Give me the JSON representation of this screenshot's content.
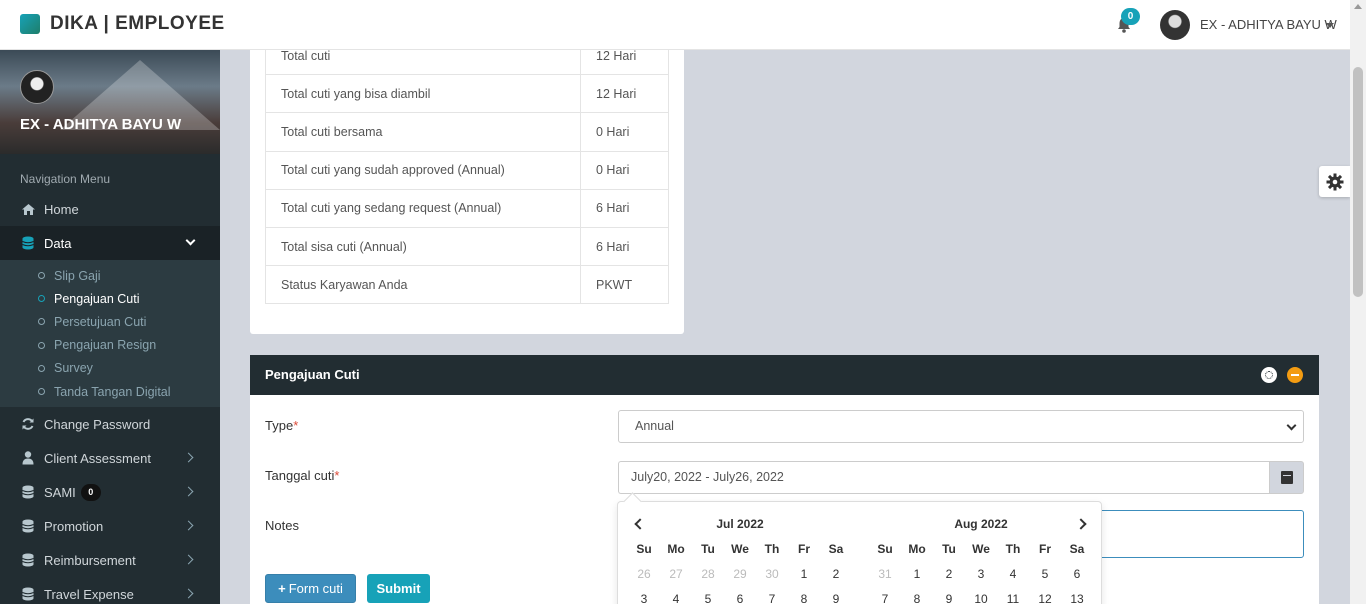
{
  "header": {
    "brand": "DIKA | EMPLOYEE",
    "notification_count": "0",
    "user_name": "EX - ADHITYA BAYU W"
  },
  "sidebar": {
    "user_name": "EX - ADHITYA BAYU W",
    "nav_header": "Navigation Menu",
    "home": "Home",
    "data": "Data",
    "sub_items": [
      "Slip Gaji",
      "Pengajuan Cuti",
      "Persetujuan Cuti",
      "Pengajuan Resign",
      "Survey",
      "Tanda Tangan Digital"
    ],
    "change_password": "Change Password",
    "client_assessment": "Client Assessment",
    "sami": "SAMI",
    "sami_badge": "0",
    "promotion": "Promotion",
    "reimbursement": "Reimbursement",
    "travel_expense": "Travel Expense"
  },
  "leave_summary": {
    "rows": [
      {
        "label": "Total cuti",
        "value": "12 Hari"
      },
      {
        "label": "Total cuti yang bisa diambil",
        "value": "12 Hari"
      },
      {
        "label": "Total cuti bersama",
        "value": "0 Hari"
      },
      {
        "label": "Total cuti yang sudah approved (Annual)",
        "value": "0 Hari"
      },
      {
        "label": "Total cuti yang sedang request (Annual)",
        "value": "6 Hari"
      },
      {
        "label": "Total sisa cuti (Annual)",
        "value": "6 Hari"
      },
      {
        "label": "Status Karyawan Anda",
        "value": "PKWT"
      }
    ]
  },
  "form": {
    "title": "Pengajuan Cuti",
    "type_label": "Type",
    "type_value": "Annual",
    "date_label": "Tanggal cuti",
    "date_value": "July20, 2022 - July26, 2022",
    "notes_label": "Notes",
    "required_mark": "*",
    "form_cuti_button": "Form cuti",
    "submit_button": "Submit"
  },
  "datepicker": {
    "dow": [
      "Su",
      "Mo",
      "Tu",
      "We",
      "Th",
      "Fr",
      "Sa"
    ],
    "left": {
      "month": "Jul 2022",
      "rows": [
        [
          {
            "d": "26",
            "off": true
          },
          {
            "d": "27",
            "off": true
          },
          {
            "d": "28",
            "off": true
          },
          {
            "d": "29",
            "off": true
          },
          {
            "d": "30",
            "off": true
          },
          {
            "d": "1",
            "off": false
          },
          {
            "d": "2",
            "off": false
          }
        ],
        [
          {
            "d": "3",
            "off": false
          },
          {
            "d": "4",
            "off": false
          },
          {
            "d": "5",
            "off": false
          },
          {
            "d": "6",
            "off": false
          },
          {
            "d": "7",
            "off": false
          },
          {
            "d": "8",
            "off": false
          },
          {
            "d": "9",
            "off": false
          }
        ]
      ]
    },
    "right": {
      "month": "Aug 2022",
      "rows": [
        [
          {
            "d": "31",
            "off": true
          },
          {
            "d": "1",
            "off": false
          },
          {
            "d": "2",
            "off": false
          },
          {
            "d": "3",
            "off": false
          },
          {
            "d": "4",
            "off": false
          },
          {
            "d": "5",
            "off": false
          },
          {
            "d": "6",
            "off": false
          }
        ],
        [
          {
            "d": "7",
            "off": false
          },
          {
            "d": "8",
            "off": false
          },
          {
            "d": "9",
            "off": false
          },
          {
            "d": "10",
            "off": false
          },
          {
            "d": "11",
            "off": false
          },
          {
            "d": "12",
            "off": false
          },
          {
            "d": "13",
            "off": false
          }
        ]
      ]
    }
  },
  "colors": {
    "accent": "#17a2b8",
    "sidebar_bg": "#222d32",
    "primary_button": "#3c8dbc",
    "warning": "#f39c12"
  }
}
